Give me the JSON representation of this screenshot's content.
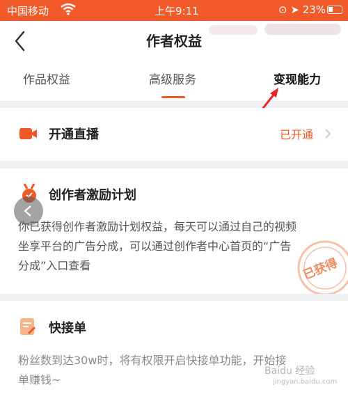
{
  "statusbar": {
    "carrier": "中国移动",
    "time": "上午9:11",
    "battery": "23%"
  },
  "navbar": {
    "title": "作者权益"
  },
  "tabs": [
    {
      "label": "作品权益"
    },
    {
      "label": "高级服务"
    },
    {
      "label": "变现能力"
    }
  ],
  "live": {
    "label": "开通直播",
    "status": "已开通"
  },
  "incentive": {
    "title": "创作者激励计划",
    "description": "你已获得创作者激励计划权益，每天可以通过自己的视频坐享平台的广告分成，可以通过创作者中心首页的“广告分成”入口查看",
    "stamp": "已获得"
  },
  "quick": {
    "title": "快接单",
    "description": "粉丝数到达30w时，将有权限开启快接单功能，开始接单赚钱~"
  },
  "watermark": {
    "text": "Baidu 经验",
    "sub": "jingyan.baidu.com"
  },
  "colors": {
    "accent": "#f05a28",
    "statusbar": "#f25a2a"
  }
}
